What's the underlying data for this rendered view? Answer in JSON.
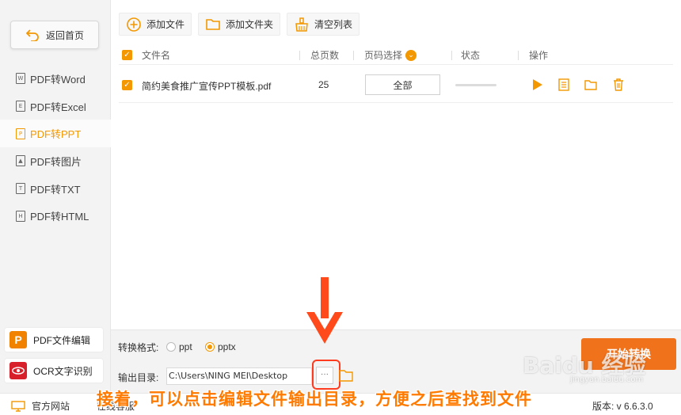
{
  "sidebar": {
    "back_label": "返回首页",
    "items": [
      {
        "label": "PDF转Word",
        "icon": "W",
        "active": false
      },
      {
        "label": "PDF转Excel",
        "icon": "E",
        "active": false
      },
      {
        "label": "PDF转PPT",
        "icon": "P",
        "active": true
      },
      {
        "label": "PDF转图片",
        "icon": "▲",
        "active": false
      },
      {
        "label": "PDF转TXT",
        "icon": "T",
        "active": false
      },
      {
        "label": "PDF转HTML",
        "icon": "H",
        "active": false
      }
    ],
    "pdf_edit_label": "PDF文件编辑",
    "pdf_edit_icon": "P",
    "ocr_label": "OCR文字识别"
  },
  "toolbar": {
    "add_file": "添加文件",
    "add_folder": "添加文件夹",
    "clear_list": "清空列表"
  },
  "table": {
    "headers": {
      "name": "文件名",
      "pages": "总页数",
      "range": "页码选择",
      "status": "状态",
      "ops": "操作"
    },
    "rows": [
      {
        "name": "简约美食推广宣传PPT模板.pdf",
        "pages": "25",
        "range": "全部"
      }
    ]
  },
  "settings": {
    "format_label": "转换格式:",
    "options": [
      "ppt",
      "pptx"
    ],
    "selected": "pptx",
    "output_label": "输出目录:",
    "output_path": "C:\\Users\\NING MEI\\Desktop",
    "browse_label": "···",
    "start_label": "开始转换"
  },
  "statusbar": {
    "site": "官方网站",
    "service": "在线客服",
    "version": "版本: v 6.6.3.0"
  },
  "overlay": {
    "caption": "接着，可以点击编辑文件输出目录，方便之后查找到文件",
    "watermark": "Baidu 经验",
    "watermark_sub": "jingyan.baidu.com"
  },
  "colors": {
    "accent": "#f39800",
    "start": "#f0731c",
    "highlight": "#ff3b1f"
  }
}
